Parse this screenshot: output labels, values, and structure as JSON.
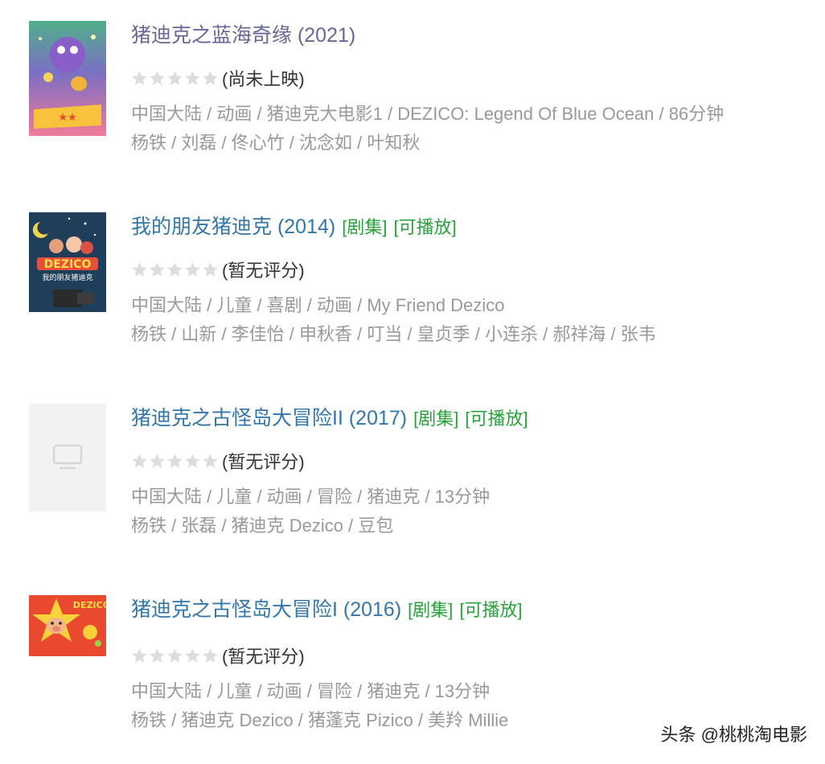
{
  "results": [
    {
      "title": "猪迪克之蓝海奇缘 (2021)",
      "title_color": "#666699",
      "tags": [],
      "rating_text": "(尚未上映)",
      "meta": "中国大陆 / 动画 / 猪迪克大电影1 / DEZICO: Legend Of Blue Ocean / 86分钟",
      "cast": "杨铁 / 刘磊 / 佟心竹 / 沈念如 / 叶知秋",
      "poster": "colorful-cartoon-poster"
    },
    {
      "title": "我的朋友猪迪克 (2014)",
      "title_color": "#3377aa",
      "tags": [
        "[剧集]",
        "[可播放]"
      ],
      "rating_text": "(暂无评分)",
      "meta": "中国大陆 / 儿童 / 喜剧 / 动画 / My Friend Dezico",
      "cast": "杨铁 / 山新 / 李佳怡 / 申秋香 / 叮当 / 皇贞季 / 小连杀 / 郝祥海 / 张韦",
      "poster": "night-sky-dezico-poster"
    },
    {
      "title": "猪迪克之古怪岛大冒险II (2017)",
      "title_color": "#3377aa",
      "tags": [
        "[剧集]",
        "[可播放]"
      ],
      "rating_text": "(暂无评分)",
      "meta": "中国大陆 / 儿童 / 动画 / 冒险 / 猪迪克 / 13分钟",
      "cast": "杨铁 / 张磊 / 猪迪克 Dezico / 豆包",
      "poster": "placeholder-tv-icon"
    },
    {
      "title": "猪迪克之古怪岛大冒险I (2016)",
      "title_color": "#3377aa",
      "tags": [
        "[剧集]",
        "[可播放]"
      ],
      "rating_text": "(暂无评分)",
      "meta": "中国大陆 / 儿童 / 动画 / 冒险 / 猪迪克 / 13分钟",
      "cast": "杨铁 / 猪迪克 Dezico / 猪蓬克 Pizico / 美羚 Millie",
      "poster": "star-pig-poster"
    }
  ],
  "watermark": "头条 @桃桃淘电影",
  "colors": {
    "link": "#3377aa",
    "visited_link": "#666699",
    "tag_green": "#2aa33c",
    "meta_gray": "#999999",
    "empty_star": "#dddddd"
  }
}
